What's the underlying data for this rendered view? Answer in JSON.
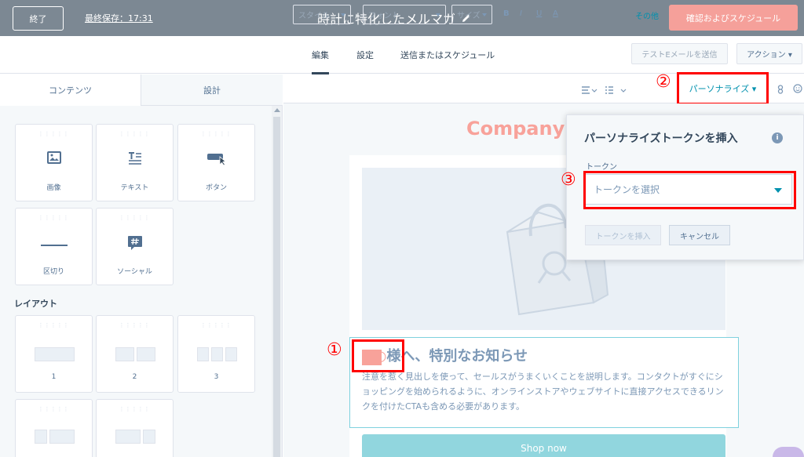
{
  "header": {
    "exit_label": "終了",
    "last_saved": "最終保存：17:31",
    "doc_title": "時計に特化したメルマガ",
    "confirm_label": "確認およびスケジュール"
  },
  "tabs": {
    "edit": "編集",
    "settings": "設定",
    "send": "送信またはスケジュール",
    "test_email": "テストEメールを送信",
    "actions": "アクション ▾"
  },
  "left_panel": {
    "tab_content": "コンテンツ",
    "tab_design": "設計",
    "blocks": [
      "画像",
      "テキスト",
      "ボタン",
      "区切り",
      "ソーシャル"
    ],
    "layout_label": "レイアウト",
    "layouts": [
      "1",
      "2",
      "3"
    ]
  },
  "toolbar": {
    "style": "スタイル",
    "font": "フォント",
    "size": "サイズ",
    "bold": "B",
    "italic": "I",
    "underline": "U",
    "color": "A",
    "other": "その他",
    "personalize": "パーソナライズ ▾"
  },
  "email": {
    "company": "Company",
    "headline": "様へ、特別なお知らせ",
    "token_placeholder": "○○",
    "paragraph": "注意を惹く見出しを使って、セールスがうまくいくことを説明します。コンタクトがすぐにショッピングを始められるように、オンラインストアやウェブサイトに直接アクセスできるリンクを付けたCTAも含める必要があります。",
    "shop_now": "Shop now"
  },
  "popup": {
    "title": "パーソナライズトークンを挿入",
    "token_label": "トークン",
    "token_select": "トークンを選択",
    "insert_label": "トークンを挿入",
    "cancel_label": "キャンセル"
  },
  "annotations": {
    "one": "①",
    "two": "②",
    "three": "③"
  }
}
